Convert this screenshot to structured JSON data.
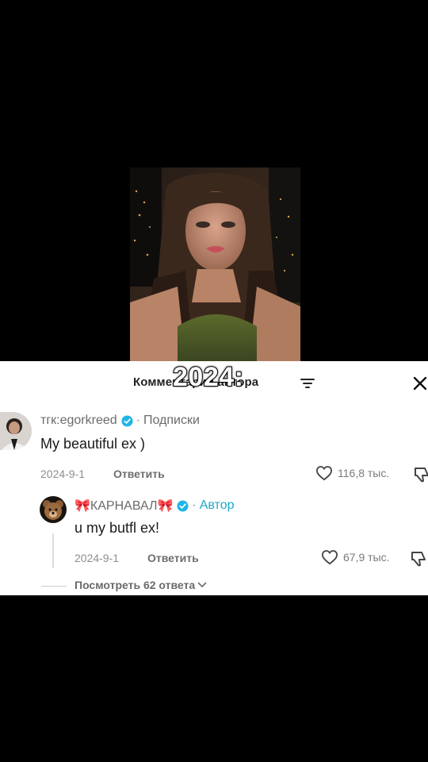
{
  "overlay": {
    "year_caption": "2024:"
  },
  "comments_panel": {
    "title": "Комментарии автора",
    "filter_icon": "filter-icon",
    "close_icon": "close-icon"
  },
  "comments": [
    {
      "username": "тгк:egorkreed",
      "verified": true,
      "tag": "Подписки",
      "text": "My beautiful ex )",
      "date": "2024-9-1",
      "reply_label": "Ответить",
      "likes": "116,8 тыс."
    }
  ],
  "replies": [
    {
      "username": "🎀КАРНАВАЛ🎀",
      "verified": true,
      "tag": "Автор",
      "avatar_icon": "bear-avatar",
      "text": "u my butfl ex!",
      "date": "2024-9-1",
      "reply_label": "Ответить",
      "likes": "67,9 тыс."
    }
  ],
  "view_more": {
    "label": "Посмотреть 62 ответа"
  },
  "colors": {
    "author_tag": "#22a7c9",
    "verified": "#20b5e6",
    "panel_bg": "#ffffff",
    "page_bg": "#000000"
  }
}
